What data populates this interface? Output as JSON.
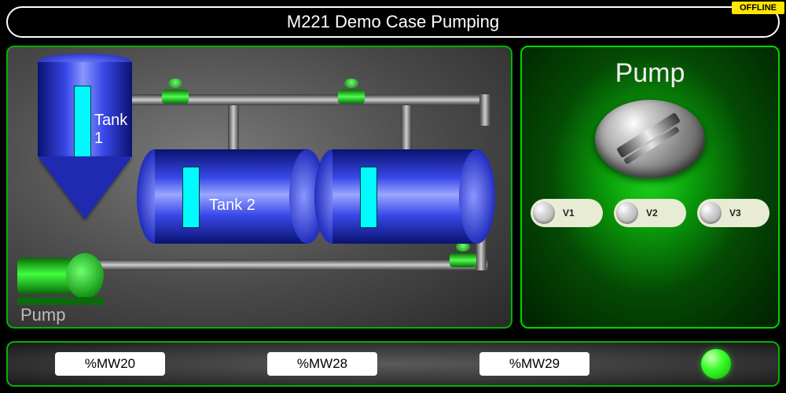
{
  "status_badge": "OFFLINE",
  "title": "M221 Demo Case Pumping",
  "process": {
    "tank1_label": "Tank 1",
    "tank2_label": "Tank 2",
    "pump_label": "Pump"
  },
  "pump_panel": {
    "title": "Pump",
    "valves": [
      {
        "label": "V1"
      },
      {
        "label": "V2"
      },
      {
        "label": "V3"
      }
    ]
  },
  "bottom": {
    "fields": [
      {
        "value": "%MW20"
      },
      {
        "value": "%MW28"
      },
      {
        "value": "%MW29"
      }
    ]
  },
  "colors": {
    "accent_green": "#00c400",
    "tank_blue": "#2a36d0",
    "level_cyan": "#00fbff",
    "offline_yellow": "#ffe600"
  }
}
